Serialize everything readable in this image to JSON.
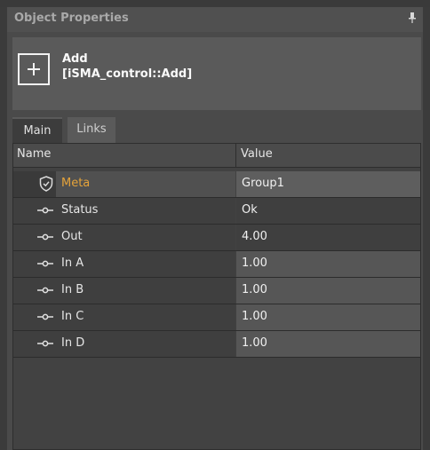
{
  "panel": {
    "title": "Object Properties"
  },
  "object": {
    "name": "Add",
    "type": "[iSMA_control::Add]"
  },
  "tabs": [
    {
      "label": "Main",
      "active": true
    },
    {
      "label": "Links",
      "active": false
    }
  ],
  "grid": {
    "headers": {
      "name": "Name",
      "value": "Value"
    },
    "rows": [
      {
        "name": "Meta",
        "value": "Group1",
        "icon": "shield-icon",
        "editable": true
      },
      {
        "name": "Status",
        "value": "Ok",
        "icon": "slot-icon",
        "editable": false
      },
      {
        "name": "Out",
        "value": "4.00",
        "icon": "slot-icon",
        "editable": false
      },
      {
        "name": "In A",
        "value": "1.00",
        "icon": "slot-icon",
        "editable": true
      },
      {
        "name": "In B",
        "value": "1.00",
        "icon": "slot-icon",
        "editable": true
      },
      {
        "name": "In C",
        "value": "1.00",
        "icon": "slot-icon",
        "editable": true
      },
      {
        "name": "In D",
        "value": "1.00",
        "icon": "slot-icon",
        "editable": true
      }
    ]
  },
  "colors": {
    "meta_label": "#e5a33a",
    "background": "#4a4a4a"
  }
}
